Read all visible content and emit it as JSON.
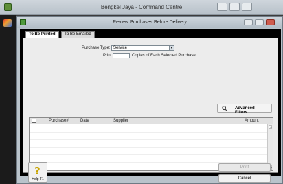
{
  "app": {
    "title": "Bengkel Jaya - Command Centre"
  },
  "dialog": {
    "title": "Review Purchases Before Delivery"
  },
  "tabs": [
    {
      "label": "To Be Printed",
      "active": true
    },
    {
      "label": "To Be Emailed",
      "active": false
    }
  ],
  "filters": {
    "purchase_type_label": "Purchase Type:",
    "purchase_type_value": "Service",
    "print_label": "Print",
    "print_copies_value": "1",
    "print_copies_suffix": "Copies of Each Selected Purchase"
  },
  "advanced_filters_label": "Advanced Filters...",
  "table": {
    "columns": [
      "Purchase#",
      "Date",
      "Supplier",
      "Amount"
    ],
    "rows": []
  },
  "footer": {
    "help_label": "Help F1",
    "print_button_label": "Print",
    "cancel_button_label": "Cancel"
  },
  "colors": {
    "background": "#3c3c3c",
    "panel": "#ececec",
    "dialog_frame": "#b9c3cb"
  }
}
